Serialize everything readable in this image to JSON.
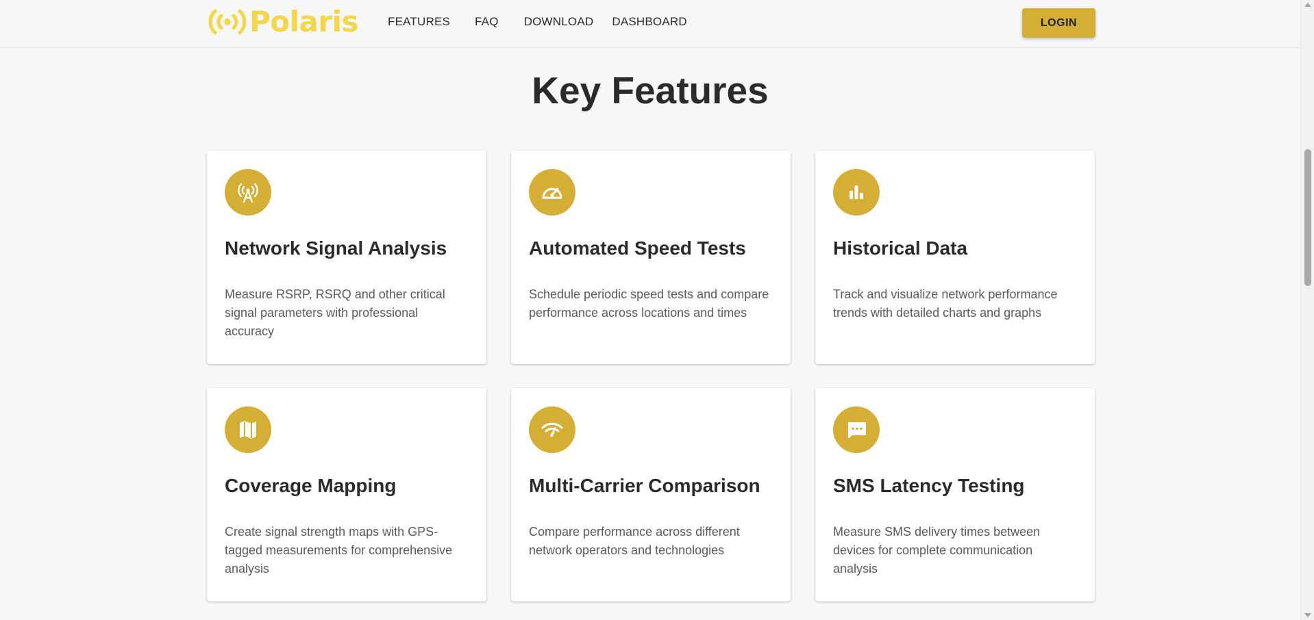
{
  "brand": {
    "name": "Polaris",
    "logo_icon": "broadcast-icon",
    "color": "#f4d64a"
  },
  "nav": {
    "items": [
      {
        "label": "FEATURES"
      },
      {
        "label": "FAQ"
      },
      {
        "label": "DOWNLOAD"
      },
      {
        "label": "DASHBOARD"
      }
    ],
    "login_label": "LOGIN"
  },
  "accent_color": "#d4ae35",
  "section": {
    "title": "Key Features",
    "features": [
      {
        "icon": "antenna-icon",
        "title": "Network Signal Analysis",
        "description": "Measure RSRP, RSRQ and other critical signal parameters with professional accuracy"
      },
      {
        "icon": "speedometer-icon",
        "title": "Automated Speed Tests",
        "description": "Schedule periodic speed tests and compare performance across locations and times"
      },
      {
        "icon": "bar-chart-icon",
        "title": "Historical Data",
        "description": "Track and visualize network performance trends with detailed charts and graphs"
      },
      {
        "icon": "map-icon",
        "title": "Coverage Mapping",
        "description": "Create signal strength maps with GPS-tagged measurements for comprehensive analysis"
      },
      {
        "icon": "network-check-icon",
        "title": "Multi-Carrier Comparison",
        "description": "Compare performance across different network operators and technologies"
      },
      {
        "icon": "sms-icon",
        "title": "SMS Latency Testing",
        "description": "Measure SMS delivery times between devices for complete communication analysis"
      }
    ]
  }
}
